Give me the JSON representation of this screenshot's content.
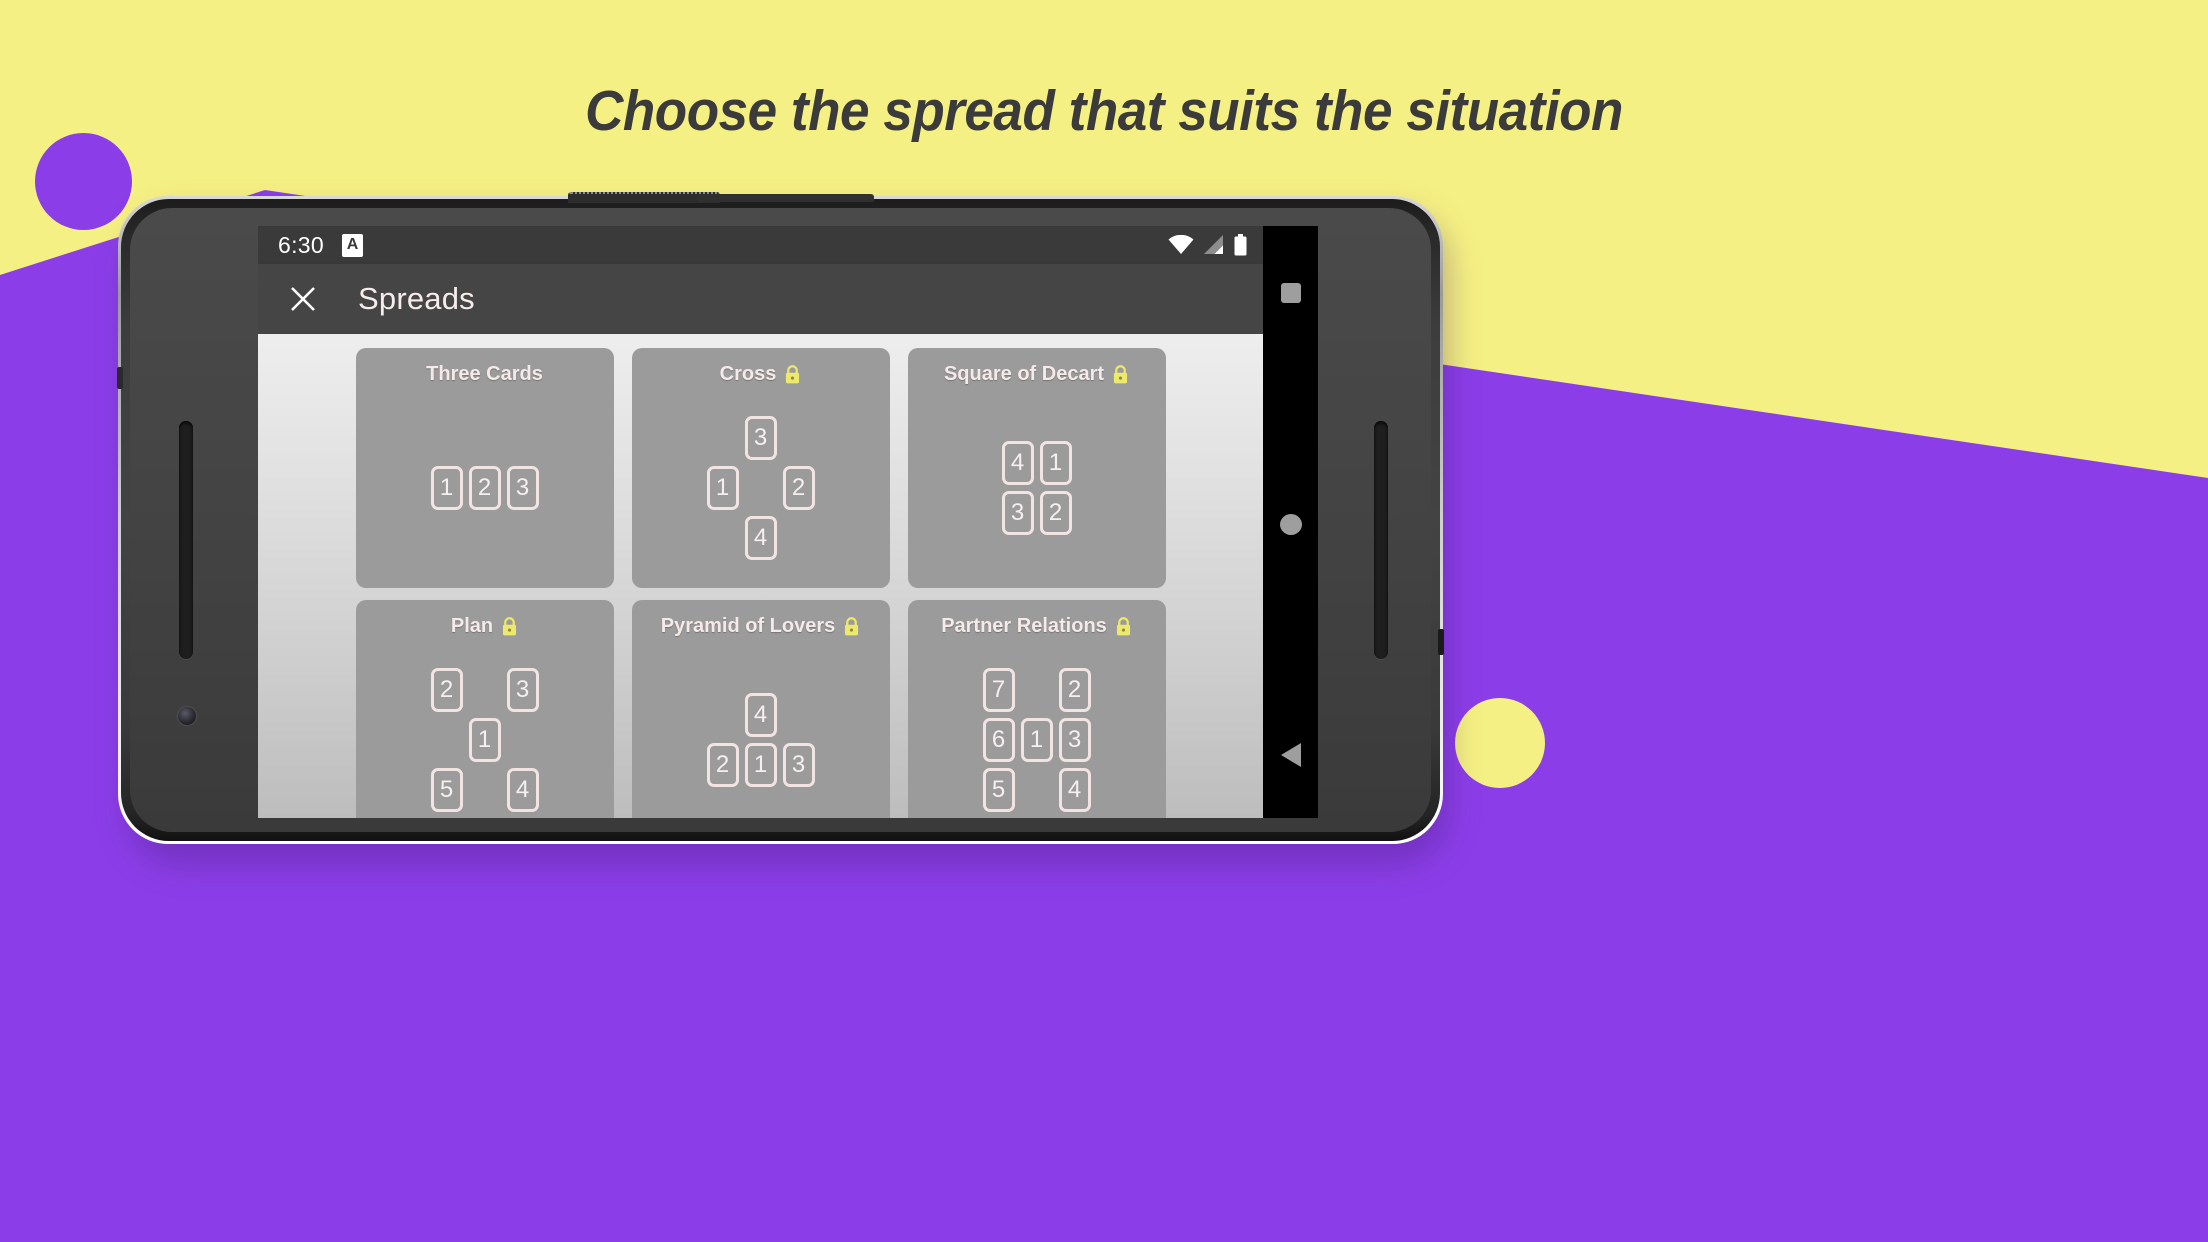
{
  "headline": "Choose the spread that suits the situation",
  "colors": {
    "bg_yellow": "#f5f083",
    "bg_purple": "#8b3ee8",
    "lock_yellow": "#ede96a",
    "appbar": "#454545",
    "statusbar": "#3a3a3a",
    "card": "#9b9b9b"
  },
  "phone": {
    "statusbar": {
      "time": "6:30",
      "app_badge_letter": "A",
      "icons": [
        "wifi-icon",
        "cell-signal-icon",
        "battery-icon"
      ]
    },
    "appbar": {
      "close_icon": "close-icon",
      "title": "Spreads"
    },
    "navbar": {
      "recents": "square-recents-icon",
      "home": "circle-home-icon",
      "back": "triangle-back-icon"
    },
    "spreads": [
      {
        "title": "Three Cards",
        "locked": false,
        "rows": [
          [
            "1",
            "2",
            "3"
          ]
        ]
      },
      {
        "title": "Cross",
        "locked": true,
        "rows": [
          [
            "",
            "3",
            ""
          ],
          [
            "1",
            "",
            "2"
          ],
          [
            "",
            "4",
            ""
          ]
        ]
      },
      {
        "title": "Square of Decart",
        "locked": true,
        "rows": [
          [
            "4",
            "1"
          ],
          [
            "3",
            "2"
          ]
        ]
      },
      {
        "title": "Plan",
        "locked": true,
        "rows": [
          [
            "2",
            "",
            "3"
          ],
          [
            "",
            "1",
            ""
          ],
          [
            "5",
            "",
            "4"
          ]
        ]
      },
      {
        "title": "Pyramid of Lovers",
        "locked": true,
        "rows": [
          [
            "",
            "4",
            ""
          ],
          [
            "2",
            "1",
            "3"
          ]
        ]
      },
      {
        "title": "Partner Relations",
        "locked": true,
        "rows": [
          [
            "7",
            "",
            "2"
          ],
          [
            "6",
            "1",
            "3"
          ],
          [
            "5",
            "",
            "4"
          ]
        ]
      }
    ]
  }
}
